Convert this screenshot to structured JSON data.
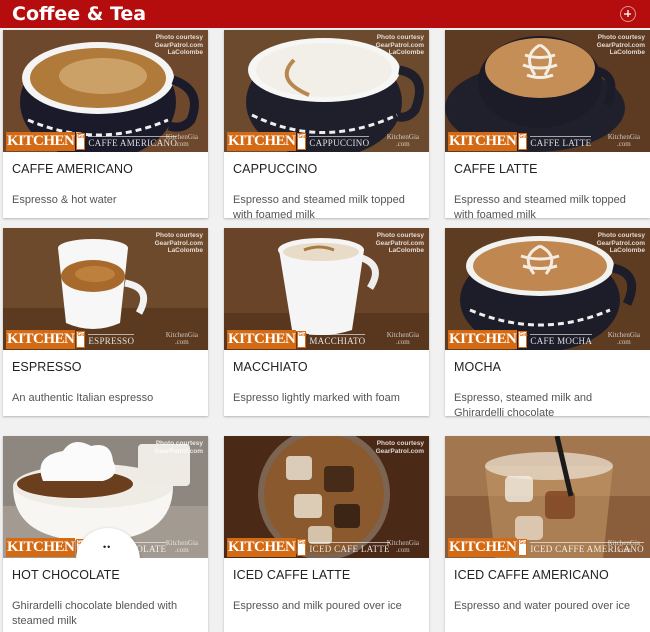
{
  "header": {
    "title": "Coffee & Tea",
    "add_icon": "add-circle-icon"
  },
  "photo_credit": {
    "line1": "Photo courtesy",
    "line2": "GearPatrol.com",
    "line3": "LaColombe"
  },
  "branding": {
    "logo_text": "KITCHEN",
    "logo_sub": "Gia",
    "watermark_name": "KitchenGia",
    "watermark_tld": ".com"
  },
  "items": [
    {
      "name": "CAFFE AMERICANO",
      "variety": "CAFFE AMERICANO",
      "description": "Espresso & hot water"
    },
    {
      "name": "CAPPUCCINO",
      "variety": "CAPPUCCINO",
      "description": "Espresso and steamed milk topped with foamed milk"
    },
    {
      "name": "CAFFE LATTE",
      "variety": "CAFFE LATTE",
      "description": "Espresso and steamed milk topped with foamed milk"
    },
    {
      "name": "ESPRESSO",
      "variety": "ESPRESSO",
      "description": "An authentic Italian espresso"
    },
    {
      "name": "MACCHIATO",
      "variety": "MACCHIATO",
      "description": "Espresso lightly marked with foam"
    },
    {
      "name": "MOCHA",
      "variety": "CAFE MOCHA",
      "description": "Espresso, steamed milk and Ghirardelli chocolate"
    },
    {
      "name": "HOT CHOCOLATE",
      "variety": "HOT CHOCOLATE",
      "description": "Ghirardelli chocolate blended with steamed milk"
    },
    {
      "name": "ICED CAFFE LATTE",
      "variety": "ICED CAFE LATTE",
      "description": "Espresso and milk poured over ice"
    },
    {
      "name": "ICED CAFFE AMERICANO",
      "variety": "ICED CAFFE AMERICANO",
      "description": "Espresso and water poured over ice"
    }
  ],
  "colors": {
    "header": "#b50d0d",
    "brand_orange": "#d46a14"
  }
}
